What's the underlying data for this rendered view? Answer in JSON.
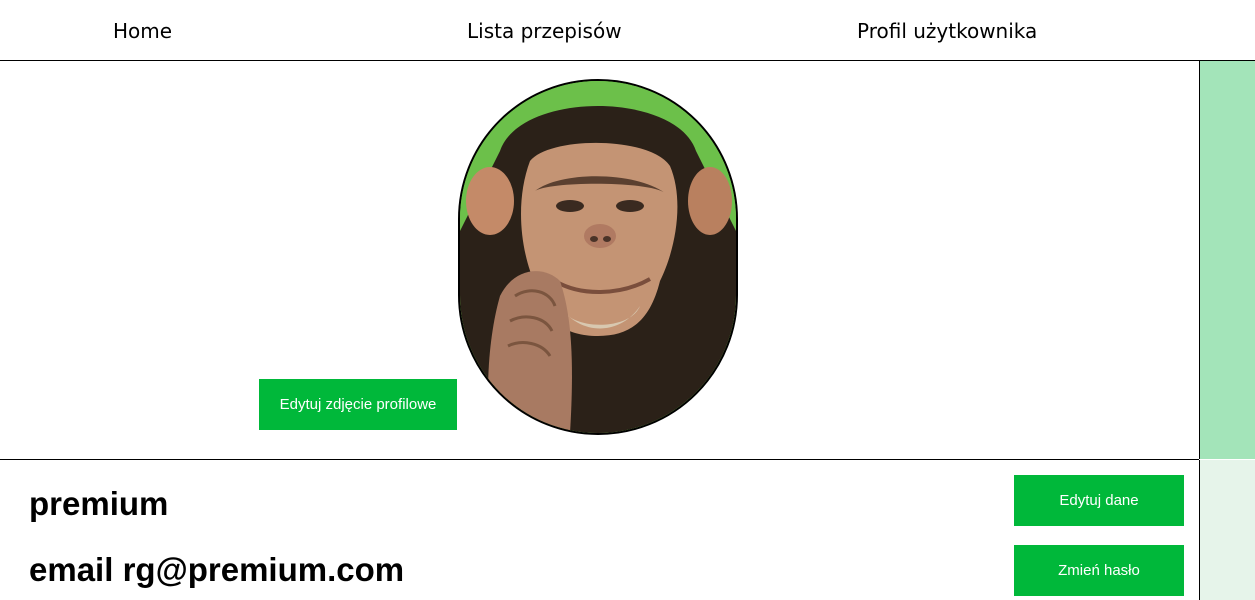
{
  "nav": {
    "home": "Home",
    "recipes": "Lista przepisów",
    "profile": "Profil użytkownika"
  },
  "profile": {
    "username": "premium",
    "email_label": "email",
    "email": "rg@premium.com",
    "avatar_icon": "chimpanzee-photo"
  },
  "buttons": {
    "edit_photo": "Edytuj zdjęcie profilowe",
    "edit_data": "Edytuj dane",
    "change_password": "Zmień hasło"
  },
  "colors": {
    "button_green": "#00b83a",
    "sidebar_green": "#a3e4b9",
    "sidebar_light": "#e6f4ea"
  }
}
